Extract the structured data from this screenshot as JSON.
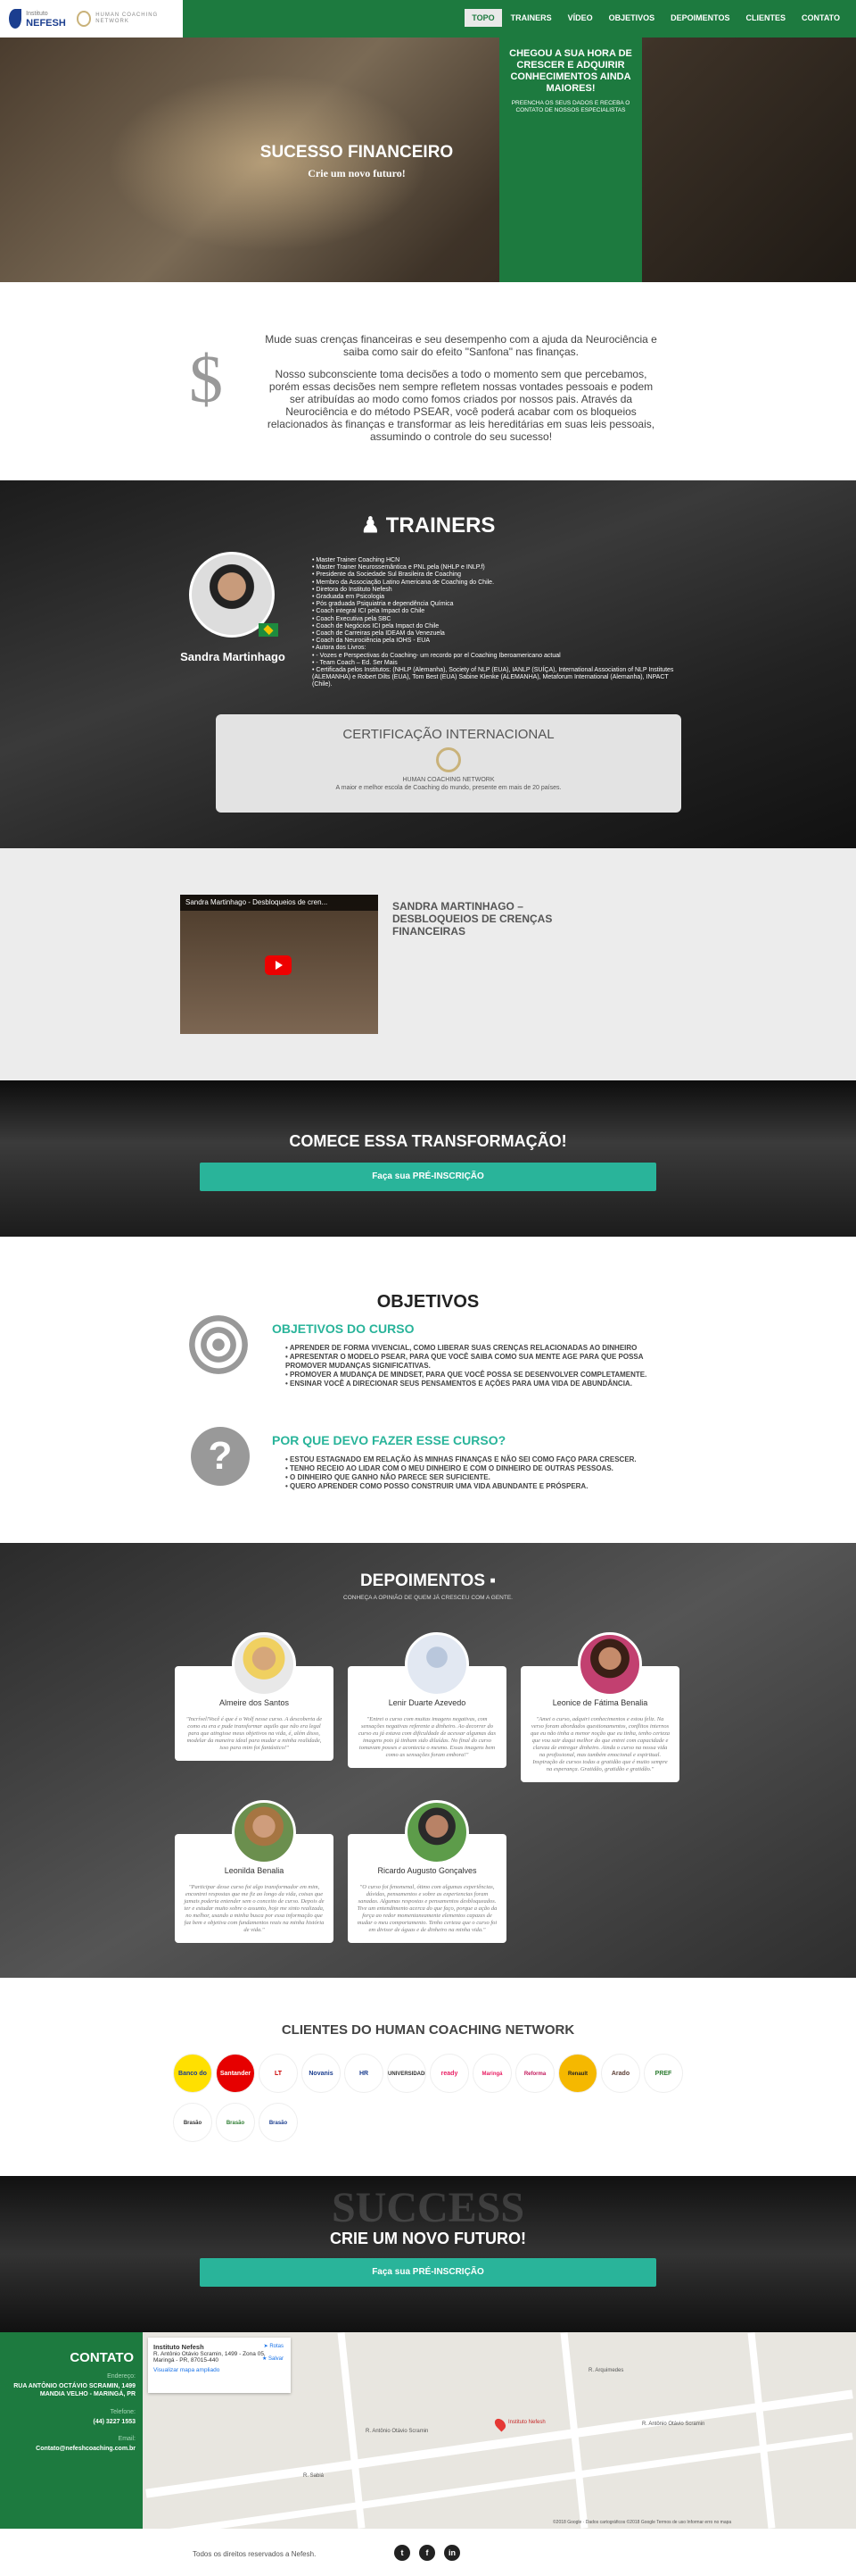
{
  "header": {
    "brand_small": "Instituto",
    "brand": "NEFESH",
    "partner": "HUMAN COACHING NETWORK",
    "nav": [
      "TOPO",
      "TRAINERS",
      "VÍDEO",
      "OBJETIVOS",
      "DEPOIMENTOS",
      "CLIENTES",
      "CONTATO"
    ],
    "active": "TOPO"
  },
  "hero": {
    "title": "SUCESSO FINANCEIRO",
    "subtitle": "Crie um novo futuro!",
    "form_title": "CHEGOU A SUA HORA DE CRESCER E ADQUIRIR CONHECIMENTOS AINDA MAIORES!",
    "form_text": "PREENCHA OS SEUS DADOS E RECEBA O CONTATO DE NOSSOS ESPECIALISTAS"
  },
  "financeiro": {
    "icon": "dollar-icon",
    "p1": "Mude suas crenças financeiras e seu desempenho com a ajuda da Neurociência e saiba como sair do efeito \"Sanfona\" nas finanças.",
    "p2": "Nosso subconsciente toma decisões a todo o momento sem que percebamos, porém essas decisões nem sempre refletem nossas vontades pessoais e podem ser atribuídas ao modo como fomos criados por nossos pais. Através da Neurociência e do método PSEAR, você poderá acabar com os bloqueios relacionados às finanças e transformar as leis hereditárias em suas leis pessoais, assumindo o controle do seu sucesso!"
  },
  "trainers": {
    "title": "TRAINERS",
    "name": "Sandra Martinhago",
    "items": [
      "Master Trainer Coaching HCN",
      "Master Trainer Neurossemântica e PNL pela (NHLP e INLP.f)",
      "Presidente da Sociedade Sul Brasileira de Coaching",
      "Membro da Associação Latino Americana de Coaching do Chile.",
      "Diretora do Instituto Nefesh",
      "Graduada em Psicologia",
      "Pós graduada Psiquiatria e dependência Química",
      "Coach integral ICI pela Impact do Chile",
      "Coach Executiva pela SBC",
      "Coach de Negócios ICI pela Impact do Chile",
      "Coach de Carreiras pela IDEAM da Venezuela",
      "Coach da Neurociência pela IOHS - EUA",
      "Autora dos Livros:",
      "- Vozes e Perspectivas do Coaching- um recordo por el Coaching Iberoamericano actual",
      "- Team Coach – Ed. Ser Mais",
      "Certificada pelos Institutos: (NHLP (Alemanha), Society of NLP (EUA), IANLP (SUÍÇA), International Association of NLP Institutes (ALEMANHA) e Robert Dilts (EUA), Tom Best (EUA) Sabine Klenke (ALEMANHA), Metaforum International (Alemanha), INPACT (Chile)."
    ],
    "cert_title": "CERTIFICAÇÃO INTERNACIONAL",
    "cert_logo": "HUMAN COACHING NETWORK",
    "cert_text": "A maior e melhor escola de Coaching do mundo, presente em mais de 20 países."
  },
  "video": {
    "bar_title": "Sandra Martinhago - Desbloqueios de cren...",
    "title": "SANDRA MARTINHAGO – DESBLOQUEIOS DE CRENÇAS FINANCEIRAS"
  },
  "transform": {
    "title": "COMECE ESSA TRANSFORMAÇÃO!",
    "button": "Faça sua PRÉ-INSCRIÇÃO"
  },
  "objetivos": {
    "title": "OBJETIVOS",
    "curso_title": "OBJETIVOS DO CURSO",
    "curso_items": [
      "APRENDER DE FORMA VIVENCIAL, COMO LIBERAR SUAS CRENÇAS RELACIONADAS AO DINHEIRO",
      "APRESENTAR O MODELO PSEAR, PARA QUE VOCÊ SAIBA COMO SUA MENTE AGE PARA QUE POSSA PROMOVER MUDANÇAS SIGNIFICATIVAS.",
      "PROMOVER A MUDANÇA DE MINDSET, PARA QUE VOCÊ POSSA SE DESENVOLVER COMPLETAMENTE.",
      "ENSINAR VOCÊ A DIRECIONAR SEUS PENSAMENTOS E AÇÕES PARA UMA VIDA DE ABUNDÂNCIA."
    ],
    "porque_title": "POR QUE DEVO FAZER ESSE CURSO?",
    "porque_items": [
      "ESTOU ESTAGNADO EM RELAÇÃO ÀS MINHAS FINANÇAS E NÃO SEI COMO FAÇO PARA CRESCER.",
      "TENHO RECEIO AO LIDAR COM O MEU DINHEIRO E COM O DINHEIRO DE OUTRAS PESSOAS.",
      "O DINHEIRO QUE GANHO NÃO PARECE SER SUFICIENTE.",
      "QUERO APRENDER COMO POSSO CONSTRUIR UMA VIDA ABUNDANTE E PRÓSPERA."
    ]
  },
  "depoimentos": {
    "title": "DEPOIMENTOS",
    "subtitle": "CONHEÇA A OPINIÃO DE QUEM JÁ CRESCEU COM A GENTE.",
    "cards": [
      {
        "name": "Almeire dos Santos",
        "text": "\"Incrível!Você é que é o Wolf nesse curso. A descoberta de como eu era e pude transformar aquilo que não era legal para que atingisse meus objetivos na vida, é, além disso, modelar da maneira ideal para mudar a minha realidade, isso para mim foi fantástico!\""
      },
      {
        "name": "Lenir Duarte Azevedo",
        "text": "\"Entrei o curso com muitas imagens negativas, com sensações negativas referente a dinheiro. Ao decorrer do curso eu já estava com dificuldade de acessar algumas das imagens pois já tinham sido diluídas. No final do curso tomavam posses e acontecia o mesmo. Essas imagens bem como as sensações foram embora!\""
      },
      {
        "name": "Leonice de Fátima Benalia",
        "text": "\"Amei o curso, adquiri conhecimentos e estou feliz. Na verso foram abordados questionamentos, conflitos internos que eu não tinha a menor noção que eu tinha, tenho certeza que vou sair daqui melhor do que entrei com capacidade e clareza de entregar dinheiro. Ainda o curso na nossa vida na profissional, mas também emocional e espiritual. Inspiração de cursos todas a gratidão que é muito sempre na esperança. Gratidão, gratidão e gratidão.\""
      },
      {
        "name": "Leonilda Benalia",
        "text": "\"Participar desse curso foi algo transformador em mim, encontrei respostas que me fiz ao longo da vida, coisas que jamais poderia entender sem o conceito de curso. Depois de ter e estudar muito sobre o assunto, hoje me sinto realizada, no melhor, usando a minha busca por essa informação que faz bem e objetiva com fundamentos reais na minha história de vida.\""
      },
      {
        "name": "Ricardo Augusto Gonçalves",
        "text": "\"O curso foi fenomenal, ótimo com algumas experiências, dúvidas, pensamentos e sobre as experiencias foram sanadas. Algumas respostas e pensamentos desbloqueados. Tive um entendimento acerca do que faço, porque a ação da força ao redor momentaneamente elementos capazes de mudar o meu comportamento. Tenho certeza que o curso foi em divisor de águas e de dinheiro na minha vida.\""
      }
    ]
  },
  "clientes": {
    "title": "CLIENTES DO HUMAN COACHING NETWORK",
    "logos": [
      "Banco do Brasil",
      "Santander",
      "LT",
      "Novanis",
      "HR",
      "UNIVERSIDADE",
      "ready",
      "Maringá",
      "Reforma",
      "Renault",
      "Arado",
      "PREF",
      "Brasão",
      "Brasão",
      "Brasão"
    ]
  },
  "futuro": {
    "bg_word": "SUCCESS",
    "title": "CRIE UM NOVO FUTURO!",
    "button": "Faça sua PRÉ-INSCRIÇÃO"
  },
  "contato": {
    "title": "CONTATO",
    "endereco_label": "Endereço:",
    "endereco": "RUA ANTÔNIO OCTÁVIO SCRAMIN, 1499 MANDIA VELHO - MARINGÁ, PR",
    "telefone_label": "Telefone:",
    "telefone": "(44) 3227 1553",
    "email_label": "Email:",
    "email": "Contato@nefeshcoaching.com.br"
  },
  "map": {
    "place": "Instituto Nefesh",
    "address": "R. Antônio Otávio Scramin, 1499 - Zona 05, Maringá - PR, 87015-440",
    "link": "Visualizar mapa ampliado",
    "route_label": "Rotas",
    "save_label": "Salvar",
    "street1": "R. Antônio Otávio Scramin",
    "street2": "R. Sabiá",
    "street3": "R. Arquimedes",
    "poi": "Instituto Nefesh",
    "attribution": "©2018 Google · Dados cartográficos ©2018 Google   Termos de uso   Informar erro no mapa"
  },
  "footer": {
    "text": "Todos os direitos reservados a Nefesh.",
    "social": [
      "twitter-icon",
      "facebook-icon",
      "linkedin-icon"
    ]
  }
}
